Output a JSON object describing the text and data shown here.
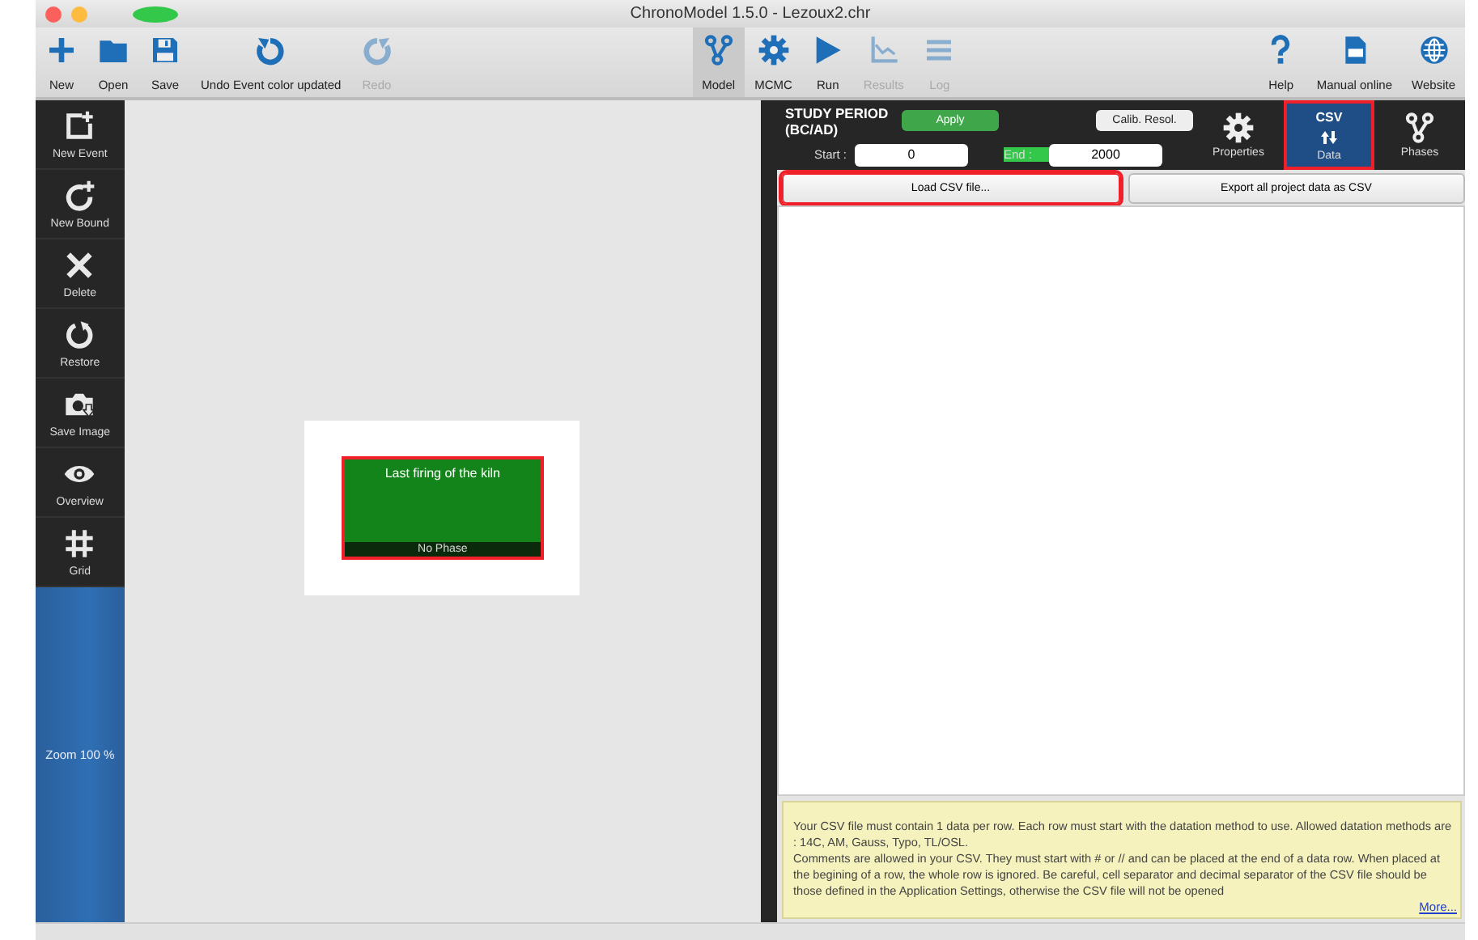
{
  "window": {
    "title": "ChronoModel 1.5.0 - Lezoux2.chr"
  },
  "toolbar": {
    "left": [
      {
        "label": "New",
        "disabled": false
      },
      {
        "label": "Open",
        "disabled": false
      },
      {
        "label": "Save",
        "disabled": false
      },
      {
        "label": "Undo Event color updated",
        "disabled": false
      },
      {
        "label": "Redo",
        "disabled": true
      }
    ],
    "center": [
      {
        "label": "Model",
        "selected": true,
        "disabled": false
      },
      {
        "label": "MCMC",
        "selected": false,
        "disabled": false
      },
      {
        "label": "Run",
        "selected": false,
        "disabled": false
      },
      {
        "label": "Results",
        "selected": false,
        "disabled": true
      },
      {
        "label": "Log",
        "selected": false,
        "disabled": true
      }
    ],
    "right": [
      {
        "label": "Help"
      },
      {
        "label": "Manual online"
      },
      {
        "label": "Website"
      }
    ]
  },
  "sidebar": {
    "items": [
      {
        "label": "New Event"
      },
      {
        "label": "New Bound"
      },
      {
        "label": "Delete"
      },
      {
        "label": "Restore"
      },
      {
        "label": "Save Image"
      },
      {
        "label": "Overview"
      },
      {
        "label": "Grid"
      }
    ],
    "zoom": "Zoom 100 %"
  },
  "canvas": {
    "events": [
      {
        "title": "Last firing of the kiln",
        "phase": "No Phase",
        "color": "#13841a",
        "selected": true
      }
    ]
  },
  "study_period": {
    "title": "STUDY PERIOD (BC/AD)",
    "apply": "Apply",
    "calib": "Calib. Resol.",
    "start_label": "Start :",
    "start": "0",
    "end_label": "End :",
    "end": "2000"
  },
  "tabs": [
    {
      "label": "Properties",
      "selected": false
    },
    {
      "label": "Data",
      "badge": "CSV",
      "selected": true
    },
    {
      "label": "Phases",
      "selected": false
    }
  ],
  "csv": {
    "buttons": [
      {
        "label": "Load CSV file...",
        "highlighted": true
      },
      {
        "label": "Export all project data as CSV",
        "highlighted": false
      }
    ],
    "help": "Your CSV file must contain 1 data per row. Each row must start with the datation method to use. Allowed datation methods are : 14C, AM, Gauss, Typo, TL/OSL.\nComments are allowed in your CSV. They must start with  # or // and can be placed at the end of a data row. When placed at the begining of a row, the whole row is ignored.  Be careful, cell separator and decimal separator of the CSV file should be those defined in the Application Settings, otherwise the CSV file will not be opened",
    "more": "More..."
  }
}
